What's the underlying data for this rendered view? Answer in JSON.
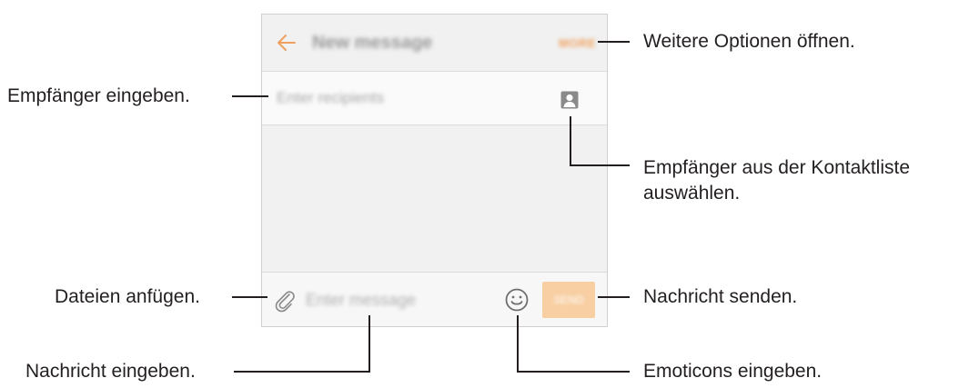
{
  "screen": {
    "appbar": {
      "title": "New message",
      "more_label": "MORE",
      "back_icon": "arrow-left-icon"
    },
    "recipient": {
      "placeholder": "Enter recipients",
      "contact_icon": "contact-card-icon"
    },
    "compose": {
      "placeholder": "Enter message",
      "attach_icon": "paperclip-icon",
      "emoticon_icon": "smiley-icon",
      "send_label": "SEND"
    }
  },
  "callouts": {
    "more_options": "Weitere Optionen öffnen.",
    "enter_recipients": "Empfänger eingeben.",
    "contacts_line1": "Empfänger aus der Kontaktliste",
    "contacts_line2": "auswählen.",
    "attach_files": "Dateien anfügen.",
    "send_message": "Nachricht senden.",
    "enter_message": "Nachricht eingeben.",
    "enter_emoticons": "Emoticons eingeben."
  },
  "colors": {
    "accent": "#f0a060",
    "send_button": "#f8cfa3",
    "callout_text": "#231f20",
    "leader_line": "#231f20"
  }
}
